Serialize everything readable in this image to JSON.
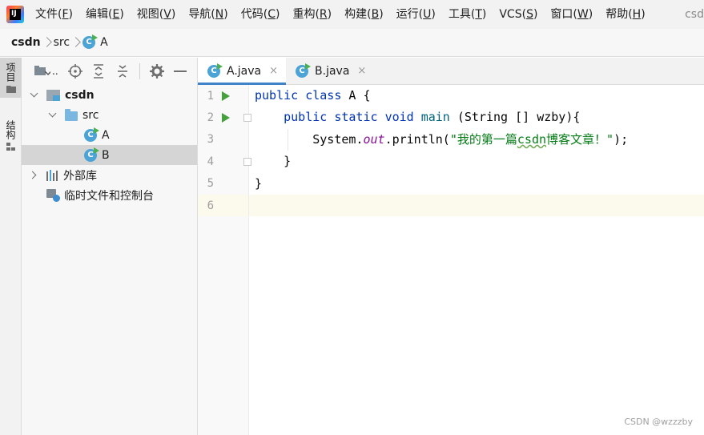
{
  "app": {
    "logo_text": "IJ",
    "title_partial": "csd"
  },
  "menu": [
    {
      "label": "文件(",
      "key": "F",
      "end": ")"
    },
    {
      "label": "编辑(",
      "key": "E",
      "end": ")"
    },
    {
      "label": "视图(",
      "key": "V",
      "end": ")"
    },
    {
      "label": "导航(",
      "key": "N",
      "end": ")"
    },
    {
      "label": "代码(",
      "key": "C",
      "end": ")"
    },
    {
      "label": "重构(",
      "key": "R",
      "end": ")"
    },
    {
      "label": "构建(",
      "key": "B",
      "end": ")"
    },
    {
      "label": "运行(",
      "key": "U",
      "end": ")"
    },
    {
      "label": "工具(",
      "key": "T",
      "end": ")"
    },
    {
      "label": "VCS(",
      "key": "S",
      "end": ")"
    },
    {
      "label": "窗口(",
      "key": "W",
      "end": ")"
    },
    {
      "label": "帮助(",
      "key": "H",
      "end": ")"
    }
  ],
  "breadcrumb": {
    "project": "csdn",
    "folder": "src",
    "file": "A",
    "file_icon_letter": "C"
  },
  "toolstrip": {
    "project_tab": "项目",
    "structure_tab": "结构"
  },
  "project_panel": {
    "toolbar_dots": "..",
    "tree": {
      "root": "csdn",
      "src": "src",
      "class_a": "A",
      "class_b": "B",
      "external_libs": "外部库",
      "scratches": "临时文件和控制台",
      "class_icon_letter": "C"
    }
  },
  "editor": {
    "tabs": [
      {
        "label": "A.java",
        "active": true
      },
      {
        "label": "B.java",
        "active": false
      }
    ],
    "close_glyph": "×",
    "line_numbers": [
      "1",
      "2",
      "3",
      "4",
      "5",
      "6"
    ],
    "code": {
      "l1_kw1": "public",
      "l1_kw2": "class",
      "l1_rest": " A {",
      "l2_kw1": "public",
      "l2_kw2": "static",
      "l2_kw3": "void",
      "l2_fn": "main",
      "l2_rest": " (String [] wzby){",
      "l3_obj": "System.",
      "l3_field": "out",
      "l3_call": ".println(",
      "l3_str_a": "\"我的第一篇",
      "l3_str_b": "csdn",
      "l3_str_c": "博客文章！\"",
      "l3_end": ");",
      "l4": "}",
      "l5": "}"
    },
    "current_line": 6
  },
  "watermark": "CSDN @wzzzby"
}
